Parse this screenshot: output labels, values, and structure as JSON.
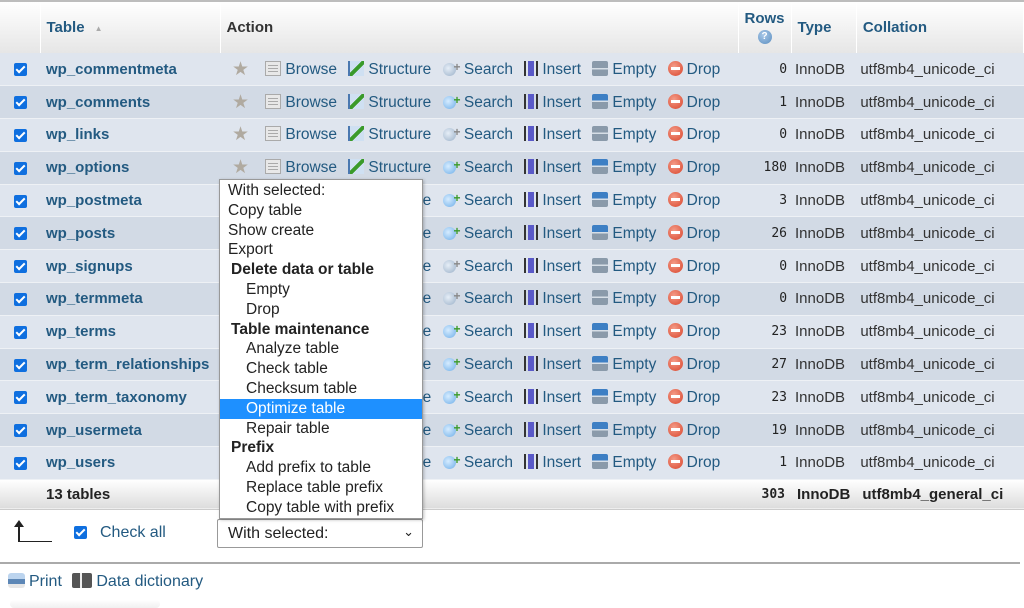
{
  "header": {
    "table_label": "Table",
    "action_label": "Action",
    "rows_label": "Rows",
    "type_label": "Type",
    "collation_label": "Collation"
  },
  "actions": {
    "browse": "Browse",
    "structure": "Structure",
    "search": "Search",
    "insert": "Insert",
    "empty": "Empty",
    "drop": "Drop"
  },
  "tables": [
    {
      "name": "wp_commentmeta",
      "rows": "0",
      "type": "InnoDB",
      "collation": "utf8mb4_unicode_ci",
      "checked": true,
      "has_data": false
    },
    {
      "name": "wp_comments",
      "rows": "1",
      "type": "InnoDB",
      "collation": "utf8mb4_unicode_ci",
      "checked": true,
      "has_data": true
    },
    {
      "name": "wp_links",
      "rows": "0",
      "type": "InnoDB",
      "collation": "utf8mb4_unicode_ci",
      "checked": true,
      "has_data": false
    },
    {
      "name": "wp_options",
      "rows": "180",
      "type": "InnoDB",
      "collation": "utf8mb4_unicode_ci",
      "checked": true,
      "has_data": true
    },
    {
      "name": "wp_postmeta",
      "rows": "3",
      "type": "InnoDB",
      "collation": "utf8mb4_unicode_ci",
      "checked": true,
      "has_data": true
    },
    {
      "name": "wp_posts",
      "rows": "26",
      "type": "InnoDB",
      "collation": "utf8mb4_unicode_ci",
      "checked": true,
      "has_data": true
    },
    {
      "name": "wp_signups",
      "rows": "0",
      "type": "InnoDB",
      "collation": "utf8mb4_unicode_ci",
      "checked": true,
      "has_data": false
    },
    {
      "name": "wp_termmeta",
      "rows": "0",
      "type": "InnoDB",
      "collation": "utf8mb4_unicode_ci",
      "checked": true,
      "has_data": false
    },
    {
      "name": "wp_terms",
      "rows": "23",
      "type": "InnoDB",
      "collation": "utf8mb4_unicode_ci",
      "checked": true,
      "has_data": true
    },
    {
      "name": "wp_term_relationships",
      "rows": "27",
      "type": "InnoDB",
      "collation": "utf8mb4_unicode_ci",
      "checked": true,
      "has_data": true
    },
    {
      "name": "wp_term_taxonomy",
      "rows": "23",
      "type": "InnoDB",
      "collation": "utf8mb4_unicode_ci",
      "checked": true,
      "has_data": true
    },
    {
      "name": "wp_usermeta",
      "rows": "19",
      "type": "InnoDB",
      "collation": "utf8mb4_unicode_ci",
      "checked": true,
      "has_data": true
    },
    {
      "name": "wp_users",
      "rows": "1",
      "type": "InnoDB",
      "collation": "utf8mb4_unicode_ci",
      "checked": true,
      "has_data": true
    }
  ],
  "footer": {
    "count_label": "13 tables",
    "total_rows": "303",
    "type": "InnoDB",
    "collation": "utf8mb4_general_ci"
  },
  "bulk": {
    "check_all_label": "Check all",
    "select_value": "With selected:"
  },
  "dropdown": {
    "items": [
      {
        "label": "With selected:",
        "kind": "option"
      },
      {
        "label": "Copy table",
        "kind": "option"
      },
      {
        "label": "Show create",
        "kind": "option"
      },
      {
        "label": "Export",
        "kind": "option"
      },
      {
        "label": "Delete data or table",
        "kind": "group"
      },
      {
        "label": "Empty",
        "kind": "sub"
      },
      {
        "label": "Drop",
        "kind": "sub"
      },
      {
        "label": "Table maintenance",
        "kind": "group"
      },
      {
        "label": "Analyze table",
        "kind": "sub"
      },
      {
        "label": "Check table",
        "kind": "sub"
      },
      {
        "label": "Checksum table",
        "kind": "sub"
      },
      {
        "label": "Optimize table",
        "kind": "sub",
        "selected": true
      },
      {
        "label": "Repair table",
        "kind": "sub"
      },
      {
        "label": "Prefix",
        "kind": "group"
      },
      {
        "label": "Add prefix to table",
        "kind": "sub"
      },
      {
        "label": "Replace table prefix",
        "kind": "sub"
      },
      {
        "label": "Copy table with prefix",
        "kind": "sub"
      }
    ]
  },
  "bottom_links": {
    "print": "Print",
    "data_dictionary": "Data dictionary"
  },
  "colors": {
    "link": "#235a81",
    "selected_option": "#1e90ff",
    "checkbox": "#0f6fdf"
  }
}
